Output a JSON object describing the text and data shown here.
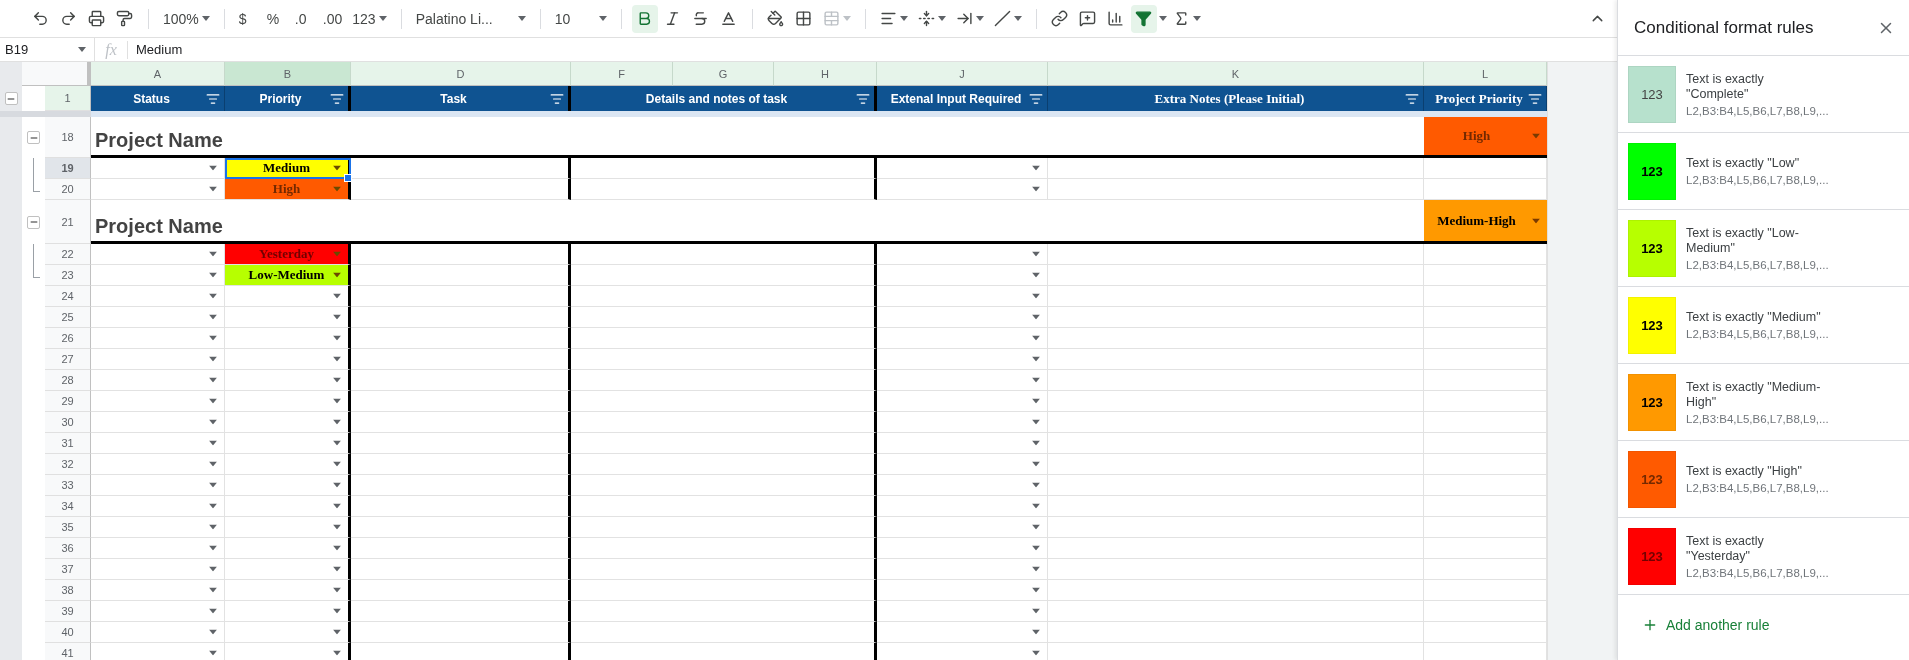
{
  "toolbar": {
    "zoom": "100%",
    "currency": "$",
    "percent": "%",
    "decrease_decimals": ".0",
    "increase_decimals": ".00",
    "number_formats": "123",
    "font": "Palatino Li...",
    "font_size": "10",
    "bold_active": true,
    "merge_disabled": true,
    "filter_active": true
  },
  "formula_bar": {
    "cell": "B19",
    "fx": "fx",
    "value": "Medium"
  },
  "columns": [
    {
      "letter": "A",
      "selected": false
    },
    {
      "letter": "B",
      "selected": true
    },
    {
      "letter": "D",
      "selected": false
    },
    {
      "letter": "F",
      "selected": false
    },
    {
      "letter": "G",
      "selected": false
    },
    {
      "letter": "H",
      "selected": false
    },
    {
      "letter": "J",
      "selected": false
    },
    {
      "letter": "K",
      "selected": false
    },
    {
      "letter": "L",
      "selected": false
    }
  ],
  "header_row": {
    "number": "1",
    "expanded": true,
    "cells": [
      "Status",
      "Priority",
      "Task",
      "Details and notes of task",
      "Extenal Input Required",
      "Extra Notes (Please Initial)",
      "Project Priority"
    ]
  },
  "rows": [
    {
      "kind": "project",
      "number": "18",
      "title": "Project Name",
      "priority": "High",
      "color": "#ff5a00",
      "expanded": true,
      "children": [
        {
          "kind": "task",
          "number": "19",
          "selected": true,
          "priority": "Medium",
          "color": "#ffff00"
        },
        {
          "kind": "task",
          "number": "20",
          "selected": false,
          "priority": "High",
          "color": "#ff5a00"
        }
      ]
    },
    {
      "kind": "project",
      "number": "21",
      "title": "Project Name",
      "priority": "Medium-High",
      "color": "#ff9900",
      "expanded": true,
      "children": [
        {
          "kind": "task",
          "number": "22",
          "selected": false,
          "priority": "Yesterday",
          "color": "#ff0000"
        },
        {
          "kind": "task",
          "number": "23",
          "selected": false,
          "priority": "Low-Medium",
          "color": "#b7ff00"
        }
      ]
    },
    {
      "kind": "task",
      "number": "24",
      "selected": false
    },
    {
      "kind": "task",
      "number": "25",
      "selected": false
    },
    {
      "kind": "task",
      "number": "26",
      "selected": false
    },
    {
      "kind": "task",
      "number": "27",
      "selected": false
    },
    {
      "kind": "task",
      "number": "28",
      "selected": false
    },
    {
      "kind": "task",
      "number": "29",
      "selected": false
    },
    {
      "kind": "task",
      "number": "30",
      "selected": false
    },
    {
      "kind": "task",
      "number": "31",
      "selected": false
    },
    {
      "kind": "task",
      "number": "32",
      "selected": false
    },
    {
      "kind": "task",
      "number": "33",
      "selected": false
    },
    {
      "kind": "task",
      "number": "34",
      "selected": false
    },
    {
      "kind": "task",
      "number": "35",
      "selected": false
    },
    {
      "kind": "task",
      "number": "36",
      "selected": false
    },
    {
      "kind": "task",
      "number": "37",
      "selected": false
    },
    {
      "kind": "task",
      "number": "38",
      "selected": false
    },
    {
      "kind": "task",
      "number": "39",
      "selected": false
    },
    {
      "kind": "task",
      "number": "40",
      "selected": false
    },
    {
      "kind": "task",
      "number": "41",
      "selected": false
    }
  ],
  "panel": {
    "title": "Conditional format rules",
    "rules": [
      {
        "condition": "Text is exactly \"Complete\"",
        "range": "L2,B3:B4,L5,B6,L7,B8,L9,...",
        "sample": "123",
        "color": "#b7e1cd",
        "bold": false
      },
      {
        "condition": "Text is exactly \"Low\"",
        "range": "L2,B3:B4,L5,B6,L7,B8,L9,...",
        "sample": "123",
        "color": "#00ff00",
        "bold": true
      },
      {
        "condition": "Text is exactly \"Low-Medium\"",
        "range": "L2,B3:B4,L5,B6,L7,B8,L9,...",
        "sample": "123",
        "color": "#b7ff00",
        "bold": true
      },
      {
        "condition": "Text is exactly \"Medium\"",
        "range": "L2,B3:B4,L5,B6,L7,B8,L9,...",
        "sample": "123",
        "color": "#ffff00",
        "bold": true
      },
      {
        "condition": "Text is exactly \"Medium-High\"",
        "range": "L2,B3:B4,L5,B6,L7,B8,L9,...",
        "sample": "123",
        "color": "#ff9900",
        "bold": true
      },
      {
        "condition": "Text is exactly \"High\"",
        "range": "L2,B3:B4,L5,B6,L7,B8,L9,...",
        "sample": "123",
        "color": "#ff5a00",
        "bold": true
      },
      {
        "condition": "Text is exactly \"Yesterday\"",
        "range": "L2,B3:B4,L5,B6,L7,B8,L9,...",
        "sample": "123",
        "color": "#ff0000",
        "bold": true
      }
    ],
    "add_rule": "Add another rule"
  }
}
